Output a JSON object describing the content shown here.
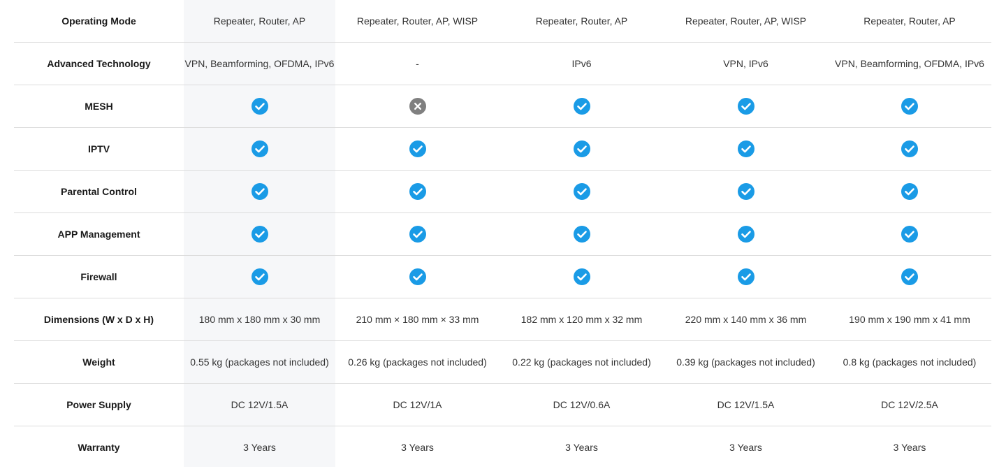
{
  "colors": {
    "check": "#1a9be6",
    "cross": "#808080",
    "highlight_column": "#f6f7f9",
    "divider": "#dcdcdc"
  },
  "rows": [
    {
      "label": "Operating Mode",
      "values": [
        "Repeater, Router, AP",
        "Repeater, Router, AP, WISP",
        "Repeater, Router, AP",
        "Repeater, Router, AP, WISP",
        "Repeater, Router, AP"
      ]
    },
    {
      "label": "Advanced Technology",
      "values": [
        "VPN, Beamforming, OFDMA, IPv6",
        "-",
        "IPv6",
        "VPN, IPv6",
        "VPN, Beamforming, OFDMA, IPv6"
      ]
    },
    {
      "label": "MESH",
      "icons": [
        "check-icon",
        "cross-icon",
        "check-icon",
        "check-icon",
        "check-icon"
      ]
    },
    {
      "label": "IPTV",
      "icons": [
        "check-icon",
        "check-icon",
        "check-icon",
        "check-icon",
        "check-icon"
      ]
    },
    {
      "label": "Parental Control",
      "icons": [
        "check-icon",
        "check-icon",
        "check-icon",
        "check-icon",
        "check-icon"
      ]
    },
    {
      "label": "APP Management",
      "icons": [
        "check-icon",
        "check-icon",
        "check-icon",
        "check-icon",
        "check-icon"
      ]
    },
    {
      "label": "Firewall",
      "icons": [
        "check-icon",
        "check-icon",
        "check-icon",
        "check-icon",
        "check-icon"
      ]
    },
    {
      "label": "Dimensions (W x D x H)",
      "values": [
        "180 mm x 180 mm x 30 mm",
        "210 mm × 180 mm × 33 mm",
        "182 mm x 120 mm x 32 mm",
        "220 mm x 140 mm x 36 mm",
        "190 mm x 190 mm x 41 mm"
      ]
    },
    {
      "label": "Weight",
      "values": [
        "0.55 kg (packages not included)",
        "0.26 kg (packages not included)",
        "0.22 kg (packages not included)",
        "0.39 kg (packages not included)",
        "0.8 kg (packages not included)"
      ]
    },
    {
      "label": "Power Supply",
      "values": [
        "DC 12V/1.5A",
        "DC 12V/1A",
        "DC 12V/0.6A",
        "DC 12V/1.5A",
        "DC 12V/2.5A"
      ]
    },
    {
      "label": "Warranty",
      "values": [
        "3 Years",
        "3 Years",
        "3 Years",
        "3 Years",
        "3 Years"
      ]
    }
  ]
}
